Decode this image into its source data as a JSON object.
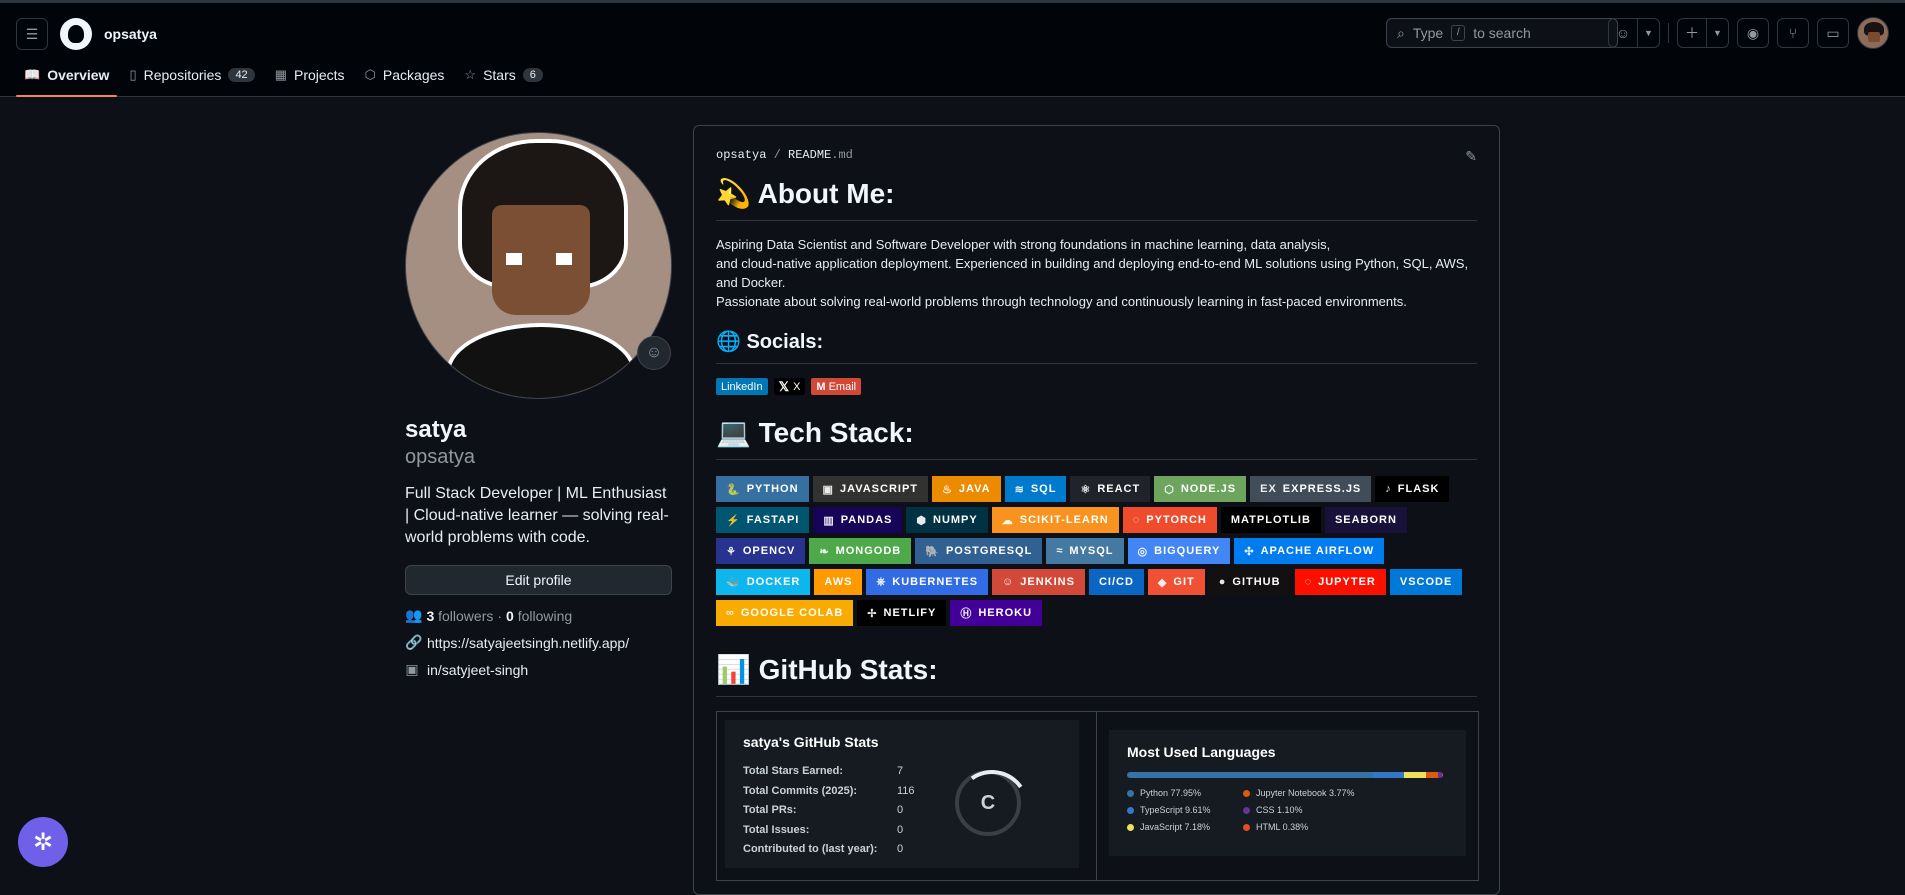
{
  "header": {
    "owner": "opsatya",
    "search_prefix": "Type",
    "search_key": "/",
    "search_suffix": "to search"
  },
  "tabs": [
    {
      "label": "Overview",
      "icon": "book-icon",
      "active": true
    },
    {
      "label": "Repositories",
      "icon": "repo-icon",
      "count": "42"
    },
    {
      "label": "Projects",
      "icon": "table-icon"
    },
    {
      "label": "Packages",
      "icon": "package-icon"
    },
    {
      "label": "Stars",
      "icon": "star-icon",
      "count": "6"
    }
  ],
  "profile": {
    "name": "satya",
    "login": "opsatya",
    "bio": "Full Stack Developer | ML Enthusiast | Cloud-native learner — solving real-world problems with code.",
    "edit_label": "Edit profile",
    "followers_count": "3",
    "followers_label": "followers",
    "dot": "·",
    "following_count": "0",
    "following_label": "following",
    "website": "https://satyajeetsingh.netlify.app/",
    "linkedin": "in/satyjeet-singh"
  },
  "readme": {
    "path_owner": "opsatya",
    "path_sep": "/",
    "path_file": "README",
    "path_ext": ".md",
    "about_title": "💫 About Me:",
    "about_lines": [
      "Aspiring Data Scientist and Software Developer with strong foundations in machine learning, data analysis,",
      "and cloud-native application deployment. Experienced in building and deploying end-to-end ML solutions using Python, SQL, AWS, and Docker.",
      "Passionate about solving real-world problems through technology and continuously learning in fast-paced environments."
    ],
    "socials_title": "🌐 Socials:",
    "socials": [
      {
        "label": "LinkedIn",
        "color": "#0077b5"
      },
      {
        "label": "X",
        "color": "#000000"
      },
      {
        "label": "Email",
        "color": "#d14836"
      }
    ],
    "tech_title": "💻 Tech Stack:",
    "tech": [
      {
        "label": "Python",
        "bg": "#3670a0",
        "icon": "🐍"
      },
      {
        "label": "JavaScript",
        "bg": "#323330",
        "icon": "▣"
      },
      {
        "label": "Java",
        "bg": "#ed8b00",
        "icon": "♨"
      },
      {
        "label": "SQL",
        "bg": "#007acc",
        "icon": "≋"
      },
      {
        "label": "React",
        "bg": "#20232a",
        "icon": "⚛"
      },
      {
        "label": "Node.js",
        "bg": "#6da55f",
        "icon": "⬡"
      },
      {
        "label": "Express.js",
        "bg": "#404d59",
        "icon": "ex"
      },
      {
        "label": "Flask",
        "bg": "#000000",
        "icon": "♪"
      },
      {
        "label": "FastAPI",
        "bg": "#005571",
        "icon": "⚡"
      },
      {
        "label": "Pandas",
        "bg": "#150458",
        "icon": "▥"
      },
      {
        "label": "NumPy",
        "bg": "#013243",
        "icon": "⬢"
      },
      {
        "label": "scikit-learn",
        "bg": "#f7931e",
        "icon": "☁"
      },
      {
        "label": "PyTorch",
        "bg": "#ee4c2c",
        "icon": "◌"
      },
      {
        "label": "Matplotlib",
        "bg": "#000000",
        "icon": ""
      },
      {
        "label": "Seaborn",
        "bg": "#18123a",
        "icon": ""
      },
      {
        "label": "OpenCV",
        "bg": "#27338e",
        "icon": "⚘"
      },
      {
        "label": "MongoDB",
        "bg": "#4ea94b",
        "icon": "❧"
      },
      {
        "label": "Postgresql",
        "bg": "#316192",
        "icon": "🐘"
      },
      {
        "label": "MySQL",
        "bg": "#4479a1",
        "icon": "≈"
      },
      {
        "label": "BigQuery",
        "bg": "#4285f4",
        "icon": "◎"
      },
      {
        "label": "Apache Airflow",
        "bg": "#017cee",
        "icon": "✣"
      },
      {
        "label": "Docker",
        "bg": "#0db7ed",
        "icon": "🐳"
      },
      {
        "label": "AWS",
        "bg": "#ff9900",
        "icon": ""
      },
      {
        "label": "Kubernetes",
        "bg": "#326ce5",
        "icon": "⎈"
      },
      {
        "label": "Jenkins",
        "bg": "#d24939",
        "icon": "☺"
      },
      {
        "label": "CI/CD",
        "bg": "#0a66c2",
        "icon": ""
      },
      {
        "label": "Git",
        "bg": "#f05033",
        "icon": "◆"
      },
      {
        "label": "GitHub",
        "bg": "#121011",
        "icon": "●"
      },
      {
        "label": "Jupyter",
        "bg": "#fa0f00",
        "icon": "◌"
      },
      {
        "label": "VSCode",
        "bg": "#0078d7",
        "icon": ""
      },
      {
        "label": "Google Colab",
        "bg": "#f9ab00",
        "icon": "∞"
      },
      {
        "label": "Netlify",
        "bg": "#000000",
        "icon": "✢"
      },
      {
        "label": "Heroku",
        "bg": "#430098",
        "icon": "Ⓗ"
      }
    ],
    "stats_title": "📊 GitHub Stats:",
    "stats_card": {
      "title": "satya's GitHub Stats",
      "rows": [
        {
          "k": "Total Stars Earned:",
          "v": "7"
        },
        {
          "k": "Total Commits (2025):",
          "v": "116"
        },
        {
          "k": "Total PRs:",
          "v": "0"
        },
        {
          "k": "Total Issues:",
          "v": "0"
        },
        {
          "k": "Contributed to (last year):",
          "v": "0"
        }
      ],
      "grade": "C"
    },
    "lang_card": {
      "title": "Most Used Languages",
      "langs": [
        {
          "label": "Python 77.95%",
          "pct": 77.95,
          "color": "#3572a5"
        },
        {
          "label": "Jupyter Notebook 3.77%",
          "pct": 3.77,
          "color": "#da5b0b"
        },
        {
          "label": "TypeScript 9.61%",
          "pct": 9.61,
          "color": "#3178c6"
        },
        {
          "label": "CSS 1.10%",
          "pct": 1.1,
          "color": "#663399"
        },
        {
          "label": "JavaScript 7.18%",
          "pct": 7.18,
          "color": "#f1e05a"
        },
        {
          "label": "HTML 0.38%",
          "pct": 0.38,
          "color": "#e34c26"
        }
      ]
    }
  }
}
